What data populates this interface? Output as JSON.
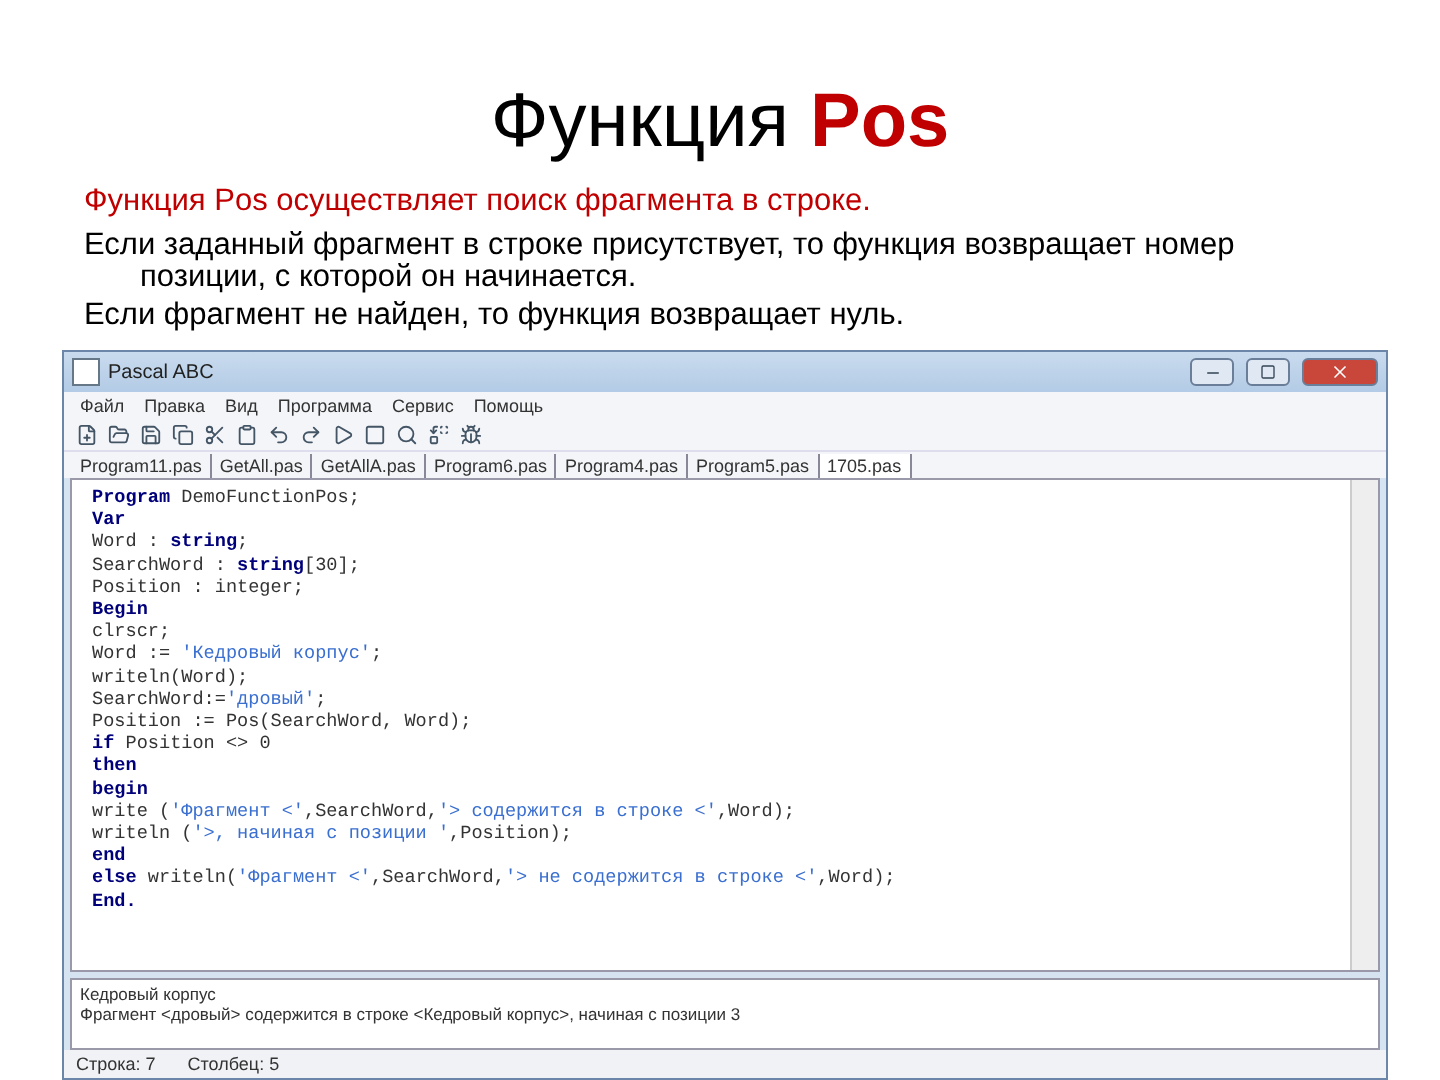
{
  "slide": {
    "title": [
      {
        "kind": "plain",
        "text": "Функция "
      },
      {
        "kind": "accent",
        "text": "Pos"
      }
    ],
    "paragraphs": [
      {
        "kind": "lead",
        "text": "Функция Pos осуществляет поиск фрагмента в строке."
      },
      {
        "kind": "body",
        "text": "Если заданный фрагмент в строке присутствует, то функция возвращает номер позиции, с которой он начинается."
      },
      {
        "kind": "body",
        "text": "Если фрагмент не найден, то функция возвращает нуль."
      }
    ]
  },
  "window": {
    "title": "Pascal ABC",
    "menu": [
      "Файл",
      "Правка",
      "Вид",
      "Программа",
      "Сервис",
      "Помощь"
    ],
    "tabs": [
      {
        "label": "Program11.pas",
        "selected": false
      },
      {
        "label": "GetAll.pas",
        "selected": false
      },
      {
        "label": "GetAllA.pas",
        "selected": false
      },
      {
        "label": "Program6.pas",
        "selected": false
      },
      {
        "label": "Program4.pas",
        "selected": false
      },
      {
        "label": "Program5.pas",
        "selected": false
      },
      {
        "label": "1705.pas",
        "selected": true
      }
    ],
    "code": [
      [
        {
          "kind": "kw",
          "text": "Program"
        },
        {
          "kind": "plain",
          "text": " DemoFunctionPos;"
        }
      ],
      [
        {
          "kind": "kw",
          "text": "Var"
        }
      ],
      [
        {
          "kind": "plain",
          "text": "Word : "
        },
        {
          "kind": "kw",
          "text": "string"
        },
        {
          "kind": "plain",
          "text": ";"
        }
      ],
      [
        {
          "kind": "plain",
          "text": "SearchWord : "
        },
        {
          "kind": "kw",
          "text": "string"
        },
        {
          "kind": "plain",
          "text": "[30];"
        }
      ],
      [
        {
          "kind": "plain",
          "text": "Position : integer;"
        }
      ],
      [
        {
          "kind": "kw",
          "text": "Begin"
        }
      ],
      [
        {
          "kind": "plain",
          "text": "clrscr;"
        }
      ],
      [
        {
          "kind": "plain",
          "text": "Word := "
        },
        {
          "kind": "str",
          "text": "'Кедровый корпус'"
        },
        {
          "kind": "plain",
          "text": ";"
        }
      ],
      [
        {
          "kind": "plain",
          "text": "writeln(Word);"
        }
      ],
      [
        {
          "kind": "plain",
          "text": "SearchWord:="
        },
        {
          "kind": "str",
          "text": "'дровый'"
        },
        {
          "kind": "plain",
          "text": ";"
        }
      ],
      [
        {
          "kind": "plain",
          "text": "Position := Pos(SearchWord, Word);"
        }
      ],
      [
        {
          "kind": "kw",
          "text": "if"
        },
        {
          "kind": "plain",
          "text": " Position <> 0"
        }
      ],
      [
        {
          "kind": "kw",
          "text": "then"
        }
      ],
      [
        {
          "kind": "kw",
          "text": "begin"
        }
      ],
      [
        {
          "kind": "plain",
          "text": "write ("
        },
        {
          "kind": "str",
          "text": "'Фрагмент <'"
        },
        {
          "kind": "plain",
          "text": ",SearchWord,"
        },
        {
          "kind": "str",
          "text": "'> содержится в строке <'"
        },
        {
          "kind": "plain",
          "text": ",Word);"
        }
      ],
      [
        {
          "kind": "plain",
          "text": "writeln ("
        },
        {
          "kind": "str",
          "text": "'>, начиная с позиции '"
        },
        {
          "kind": "plain",
          "text": ",Position);"
        }
      ],
      [
        {
          "kind": "kw",
          "text": "end"
        }
      ],
      [
        {
          "kind": "kw",
          "text": "else"
        },
        {
          "kind": "plain",
          "text": " writeln("
        },
        {
          "kind": "str",
          "text": "'Фрагмент <'"
        },
        {
          "kind": "plain",
          "text": ",SearchWord,"
        },
        {
          "kind": "str",
          "text": "'> не содержится в строке <'"
        },
        {
          "kind": "plain",
          "text": ",Word);"
        }
      ],
      [
        {
          "kind": "kw",
          "text": "End."
        }
      ]
    ],
    "output": [
      "Кедровый корпус",
      "Фрагмент <дровый> содержится в строке <Кедровый корпус>, начиная с позиции 3"
    ],
    "status_bar": [
      "Строка: 7",
      "Столбец: 5"
    ]
  }
}
